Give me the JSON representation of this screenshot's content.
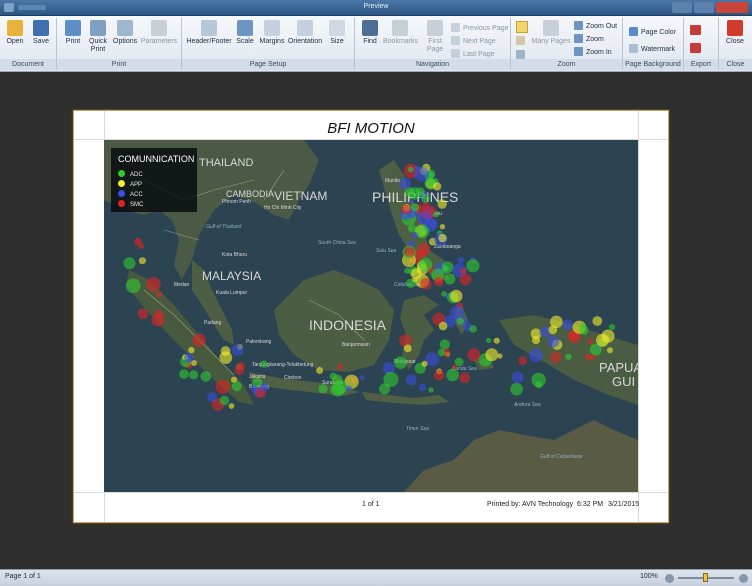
{
  "window": {
    "title": "Preview"
  },
  "ribbon": {
    "groups": {
      "document": "Document",
      "print": "Print",
      "page_setup": "Page Setup",
      "navigation": "Navigation",
      "zoom": "Zoom",
      "page_background": "Page Background",
      "export": "Export",
      "close": "Close"
    },
    "buttons": {
      "open": "Open",
      "save": "Save",
      "print": "Print",
      "quick_print_1": "Quick",
      "quick_print_2": "Print",
      "options": "Options",
      "parameters": "Parameters",
      "header_footer": "Header/Footer",
      "scale": "Scale",
      "margins": "Margins",
      "orientation": "Orientation",
      "size": "Size",
      "find": "Find",
      "bookmarks": "Bookmarks",
      "first_page_1": "First",
      "first_page_2": "Page",
      "previous_page": "Previous Page",
      "next_page": "Next Page",
      "last_page": "Last Page",
      "many_pages": "Many Pages",
      "zoom_out": "Zoom Out",
      "zoom": "Zoom",
      "zoom_in": "Zoom In",
      "page_color": "Page Color",
      "watermark": "Watermark",
      "close": "Close"
    }
  },
  "document": {
    "title": "BFI MOTION",
    "footer_page": "1 of 1",
    "footer_printed_by": "Printed by:",
    "footer_author": "AVN Technology",
    "footer_time": "6:32 PM",
    "footer_date": "3/21/2015"
  },
  "map": {
    "legend_title": "COMUNNICATION",
    "legend_items": [
      {
        "label": "ADC",
        "color": "#2ecc2e"
      },
      {
        "label": "APP",
        "color": "#f2ee2a"
      },
      {
        "label": "ACC",
        "color": "#3a4fe0"
      },
      {
        "label": "SMC",
        "color": "#e02424"
      }
    ],
    "countries": {
      "thailand": "THAILAND",
      "cambodia": "CAMBODIA",
      "vietnam": "VIETNAM",
      "philippines": "PHILIPPINES",
      "malaysia": "MALAYSIA",
      "indonesia": "INDONESIA",
      "papua": "PAPUA",
      "guinea": "GUI"
    },
    "places": {
      "phnom_penh": "Phnom Penh",
      "ho_chi_minh": "Ho Chi Minh City",
      "gulf_thailand": "Gulf of Thailand",
      "south_china_sea": "South China Sea",
      "sulu_sea": "Sulu Sea",
      "celebes_sea": "Celebes Sea",
      "cebu": "Cebu",
      "zamboanga": "Zamboanga",
      "manila": "Manila",
      "kota_bharu": "Kota Bharu",
      "kuala_lumpur": "Kuala Lumpur",
      "medan": "Medan",
      "padang": "Padang",
      "palembang": "Palembang",
      "tanjungkarang": "Tanjungkarang-Telukbetung",
      "jakarta": "Jakarta",
      "bandung": "Bandung",
      "surabaya": "Surabaya",
      "cirebon": "Cirebon",
      "banjarmasin": "Banjarmasin",
      "makassar": "Makassar",
      "banda_sea": "Banda Sea",
      "arafura_sea": "Arafura Sea",
      "timor_sea": "Timor Sea",
      "gulf_carpentaria": "Gulf of Carpentaria"
    }
  },
  "statusbar": {
    "page": "Page 1 of 1",
    "zoom": "100%"
  }
}
